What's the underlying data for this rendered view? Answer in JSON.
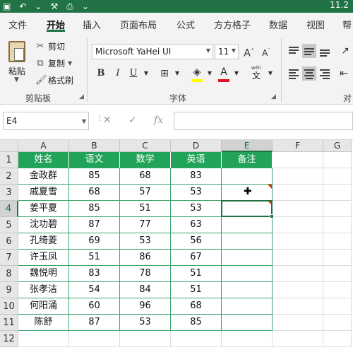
{
  "titlebar": {
    "qat_icons": [
      "save-icon",
      "undo-icon",
      "redo-icon",
      "format-painter-icon",
      "print-icon",
      "customize-icon"
    ],
    "title_fragment": "11.2"
  },
  "ribbon_tabs": [
    "文件",
    "开始",
    "插入",
    "页面布局",
    "公式",
    "方方格子",
    "数据",
    "视图",
    "帮"
  ],
  "active_tab": "开始",
  "clipboard": {
    "paste_label": "粘贴",
    "cut_label": "剪切",
    "copy_label": "复制",
    "format_painter_label": "格式刷",
    "group_label": "剪贴板"
  },
  "font": {
    "font_name": "Microsoft YaHei UI",
    "font_size": "11",
    "grow_label": "A",
    "shrink_label": "A",
    "bold_label": "B",
    "italic_label": "I",
    "underline_label": "U",
    "font_color_label": "A",
    "phonetic_label": "wén",
    "phonetic_char": "文",
    "group_label": "字体",
    "highlight_color": "#ffff00",
    "font_color": "#e81123"
  },
  "alignment": {
    "group_label": "对"
  },
  "formula_bar": {
    "name_box": "E4",
    "cancel_glyph": "✕",
    "enter_glyph": "✓",
    "fx_label": "fx",
    "formula": ""
  },
  "sheet": {
    "columns": [
      "A",
      "B",
      "C",
      "D",
      "E",
      "F",
      "G"
    ],
    "rows": [
      "1",
      "2",
      "3",
      "4",
      "5",
      "6",
      "7",
      "8",
      "9",
      "10",
      "11",
      "12"
    ],
    "selected_cell": "E4",
    "header_fill": "#22a35a",
    "data_border": "#3aa56a",
    "table_header": [
      "姓名",
      "语文",
      "数学",
      "英语",
      "备注"
    ],
    "table_rows": [
      [
        "金政群",
        "85",
        "68",
        "83",
        ""
      ],
      [
        "戚夏雪",
        "68",
        "57",
        "53",
        ""
      ],
      [
        "姜平夏",
        "85",
        "51",
        "53",
        ""
      ],
      [
        "沈功碧",
        "87",
        "77",
        "63",
        ""
      ],
      [
        "孔绮菱",
        "69",
        "53",
        "56",
        ""
      ],
      [
        "许玉凤",
        "51",
        "86",
        "67",
        ""
      ],
      [
        "魏悦明",
        "83",
        "78",
        "51",
        ""
      ],
      [
        "张孝洁",
        "54",
        "84",
        "51",
        ""
      ],
      [
        "何阳涌",
        "60",
        "96",
        "68",
        ""
      ],
      [
        "陈舒",
        "87",
        "53",
        "85",
        ""
      ]
    ]
  }
}
